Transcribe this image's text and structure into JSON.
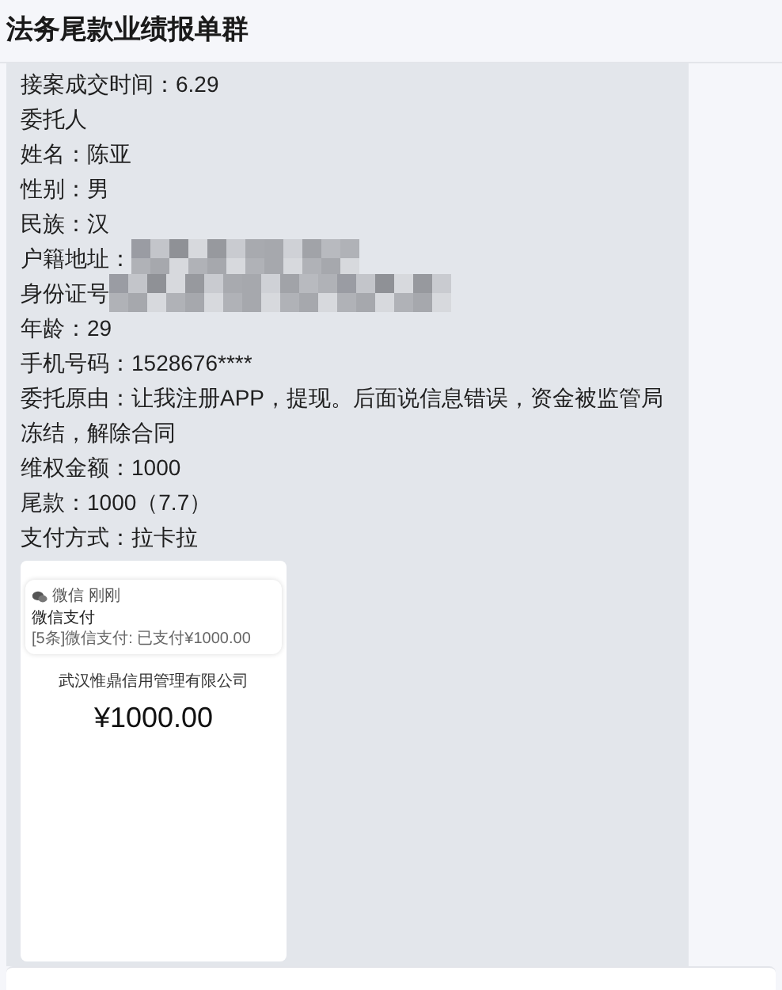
{
  "header": {
    "title": "法务尾款业绩报单群"
  },
  "message": {
    "lines": [
      {
        "kind": "text",
        "text": "接案成交时间：6.29"
      },
      {
        "kind": "text",
        "text": "委托人"
      },
      {
        "kind": "text",
        "text": "姓名：陈亚"
      },
      {
        "kind": "text",
        "text": "性别：男"
      },
      {
        "kind": "text",
        "text": "民族：汉"
      },
      {
        "kind": "redacted",
        "text": "户籍地址："
      },
      {
        "kind": "redacted",
        "text": "身份证号"
      },
      {
        "kind": "text",
        "text": "年龄：29"
      },
      {
        "kind": "text",
        "text": "手机号码：1528676****"
      },
      {
        "kind": "text",
        "text": "委托原由：让我注册APP，提现。后面说信息错误，资金被监管局冻结，解除合同"
      },
      {
        "kind": "text",
        "text": "维权金额：1000"
      },
      {
        "kind": "text",
        "text": "尾款：1000（7.7）"
      },
      {
        "kind": "text",
        "text": "支付方式：拉卡拉"
      }
    ],
    "image": {
      "notification": {
        "app": "微信",
        "time": "刚刚",
        "title": "微信支付",
        "body": "[5条]微信支付: 已支付¥1000.00"
      },
      "payee": "武汉惟鼎信用管理有限公司",
      "amount": "¥1000.00"
    }
  }
}
